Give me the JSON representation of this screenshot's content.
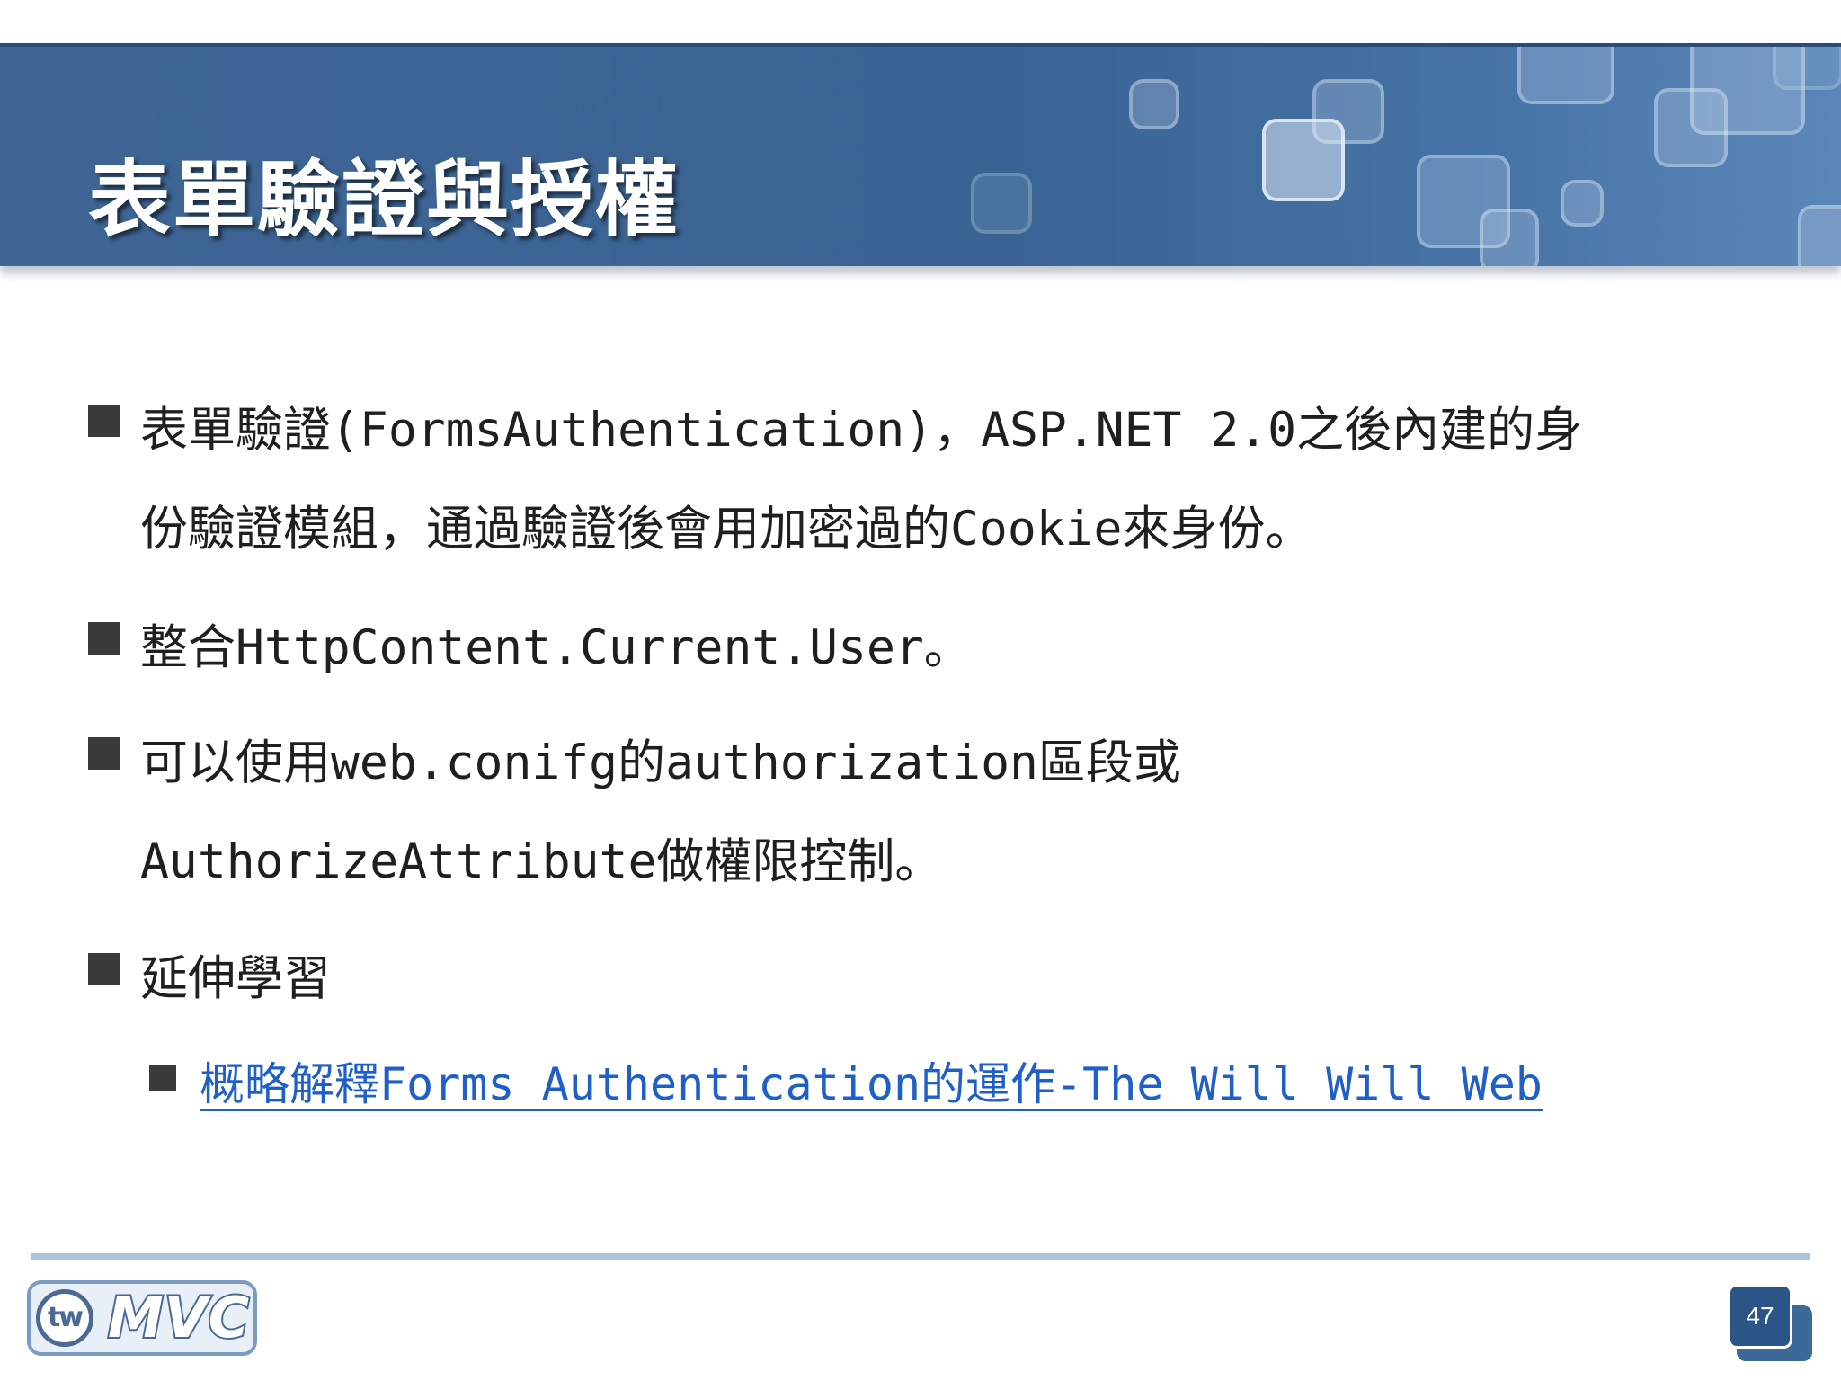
{
  "slide": {
    "title": "表單驗證與授權",
    "bullets": [
      {
        "lines": [
          "表單驗證(FormsAuthentication)，ASP.NET 2.0之後內建的身",
          "份驗證模組，通過驗證後會用加密過的Cookie來身份。"
        ]
      },
      {
        "lines": [
          "整合HttpContent.Current.User。"
        ]
      },
      {
        "lines": [
          "可以使用web.conifg的authorization區段或",
          "AuthorizeAttribute做權限控制。"
        ]
      },
      {
        "lines": [
          "延伸學習"
        ]
      }
    ],
    "sub_link": {
      "text": "概略解釋Forms Authentication的運作-The Will Will Web",
      "color": "#1f5fc8"
    },
    "footer": {
      "logo_badge": "tw",
      "logo_text": "MVC",
      "page_number": "47"
    },
    "colors": {
      "banner": "#3e6594",
      "title_text": "#ffffff",
      "body_text": "#1f1f1f",
      "footer_rule": "#a9c3db",
      "page_badge": "#2a5586"
    }
  }
}
